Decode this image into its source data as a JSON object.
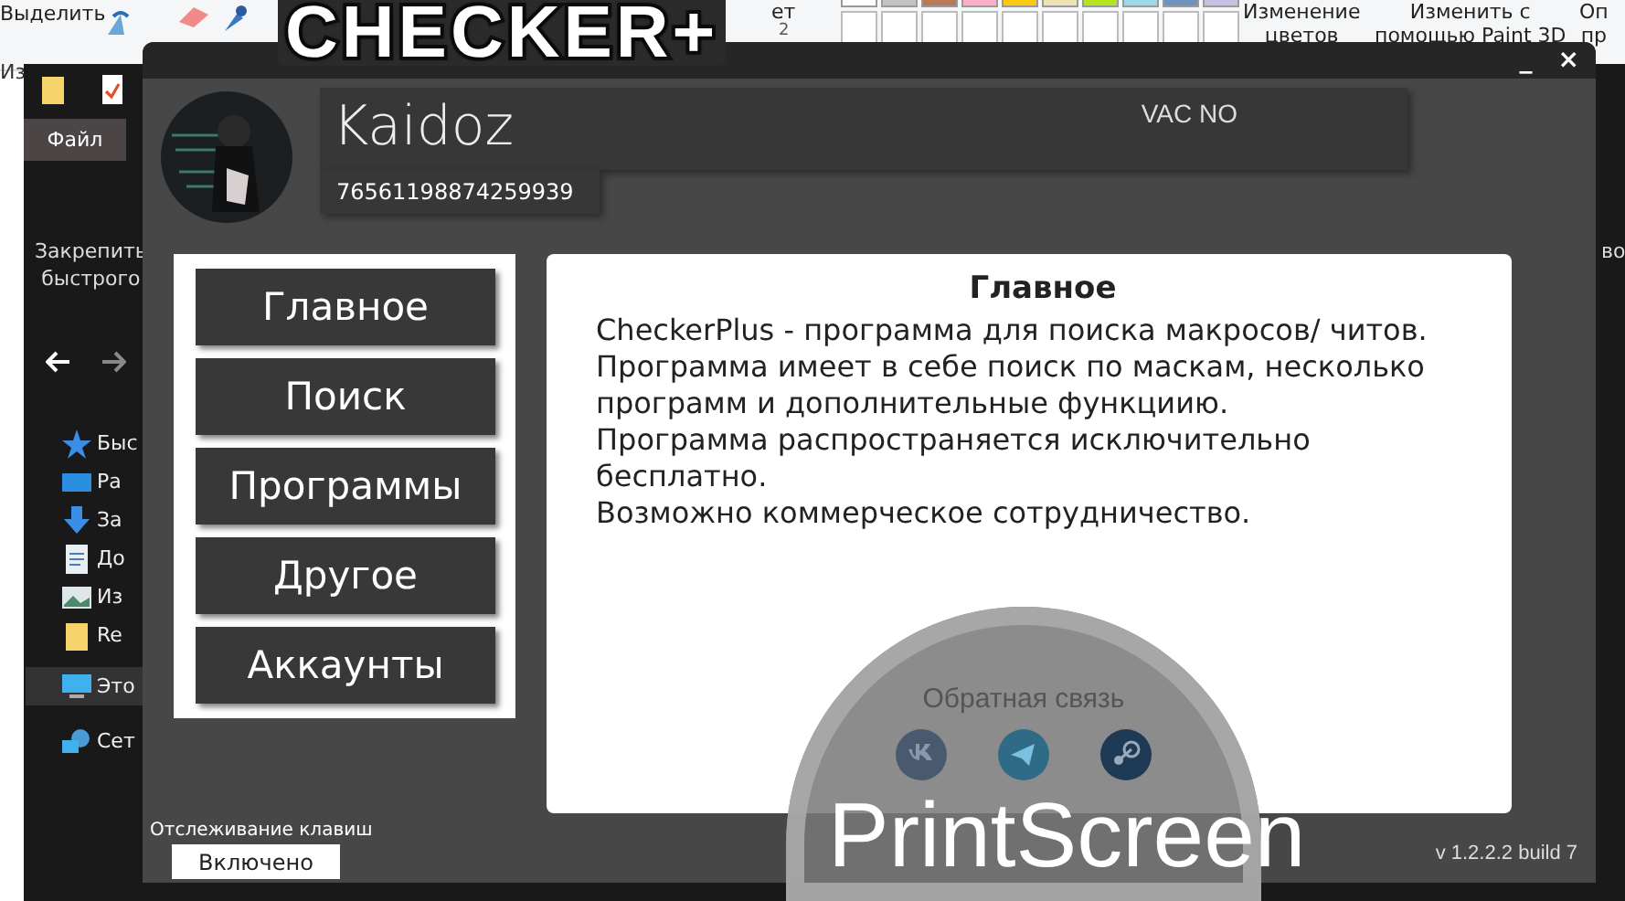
{
  "paint_ribbon": {
    "select_label": "Выделить",
    "color_label": "ет",
    "color_sub": "2",
    "left_tab": "Из",
    "palette": [
      {
        "color": "#ffffff"
      },
      {
        "color": "#c3c3c3"
      },
      {
        "color": "#b97a57"
      },
      {
        "color": "#ffaec9"
      },
      {
        "color": "#ffc90e"
      },
      {
        "color": "#efe4b0"
      },
      {
        "color": "#b5e61d"
      },
      {
        "color": "#99d9ea"
      },
      {
        "color": "#7092be"
      },
      {
        "color": "#c8bfe7"
      }
    ],
    "commands": [
      "Изменение\nцветов",
      "Изменить с\nпомощью Paint 3D",
      "Оп\nпр"
    ]
  },
  "explorer": {
    "file_tab": "Файл",
    "pin_label": "Закрепить\nбыстрого",
    "right_label": "во",
    "tree": [
      {
        "label": "Быс",
        "kind": "star",
        "selected": false
      },
      {
        "label": "Ра",
        "kind": "desktop",
        "selected": false
      },
      {
        "label": "За",
        "kind": "download",
        "selected": false
      },
      {
        "label": "До",
        "kind": "document",
        "selected": false
      },
      {
        "label": "Из",
        "kind": "image",
        "selected": false
      },
      {
        "label": "Re",
        "kind": "folder",
        "selected": false
      },
      {
        "label": "Это",
        "kind": "computer",
        "selected": true
      },
      {
        "label": "Сет",
        "kind": "network",
        "selected": false
      }
    ]
  },
  "overlay_title": "CHECKER+",
  "app": {
    "window_controls": [
      "_",
      "×"
    ],
    "profile": {
      "name": "Kaidoz",
      "steam_id": "76561198874259939",
      "vac": "VAC NO"
    },
    "menu": [
      {
        "label": "Главное"
      },
      {
        "label": "Поиск"
      },
      {
        "label": "Программы"
      },
      {
        "label": "Другое"
      },
      {
        "label": "Аккаунты"
      }
    ],
    "content": {
      "title": "Главное",
      "paragraphs": [
        "CheckerPlus - программа для поиска макросов/ читов.",
        "Программа имеет в себе поиск по маскам, несколько программ и дополнительные функциию.",
        "Программа распространяется исключительно бесплатно.",
        "Возможно коммерческое сотрудничество."
      ]
    },
    "feedback": {
      "title": "Обратная связь",
      "links": [
        {
          "kind": "vk",
          "color": "#4a5a6e"
        },
        {
          "kind": "telegram",
          "color": "#2f6a87"
        },
        {
          "kind": "steam",
          "color": "#1f3a55"
        }
      ]
    },
    "key_tracking": {
      "label": "Отслеживание клавиш",
      "button": "Включено",
      "on": true
    },
    "version": "v 1.2.2.2 build 7"
  },
  "caption": "PrintScreen"
}
